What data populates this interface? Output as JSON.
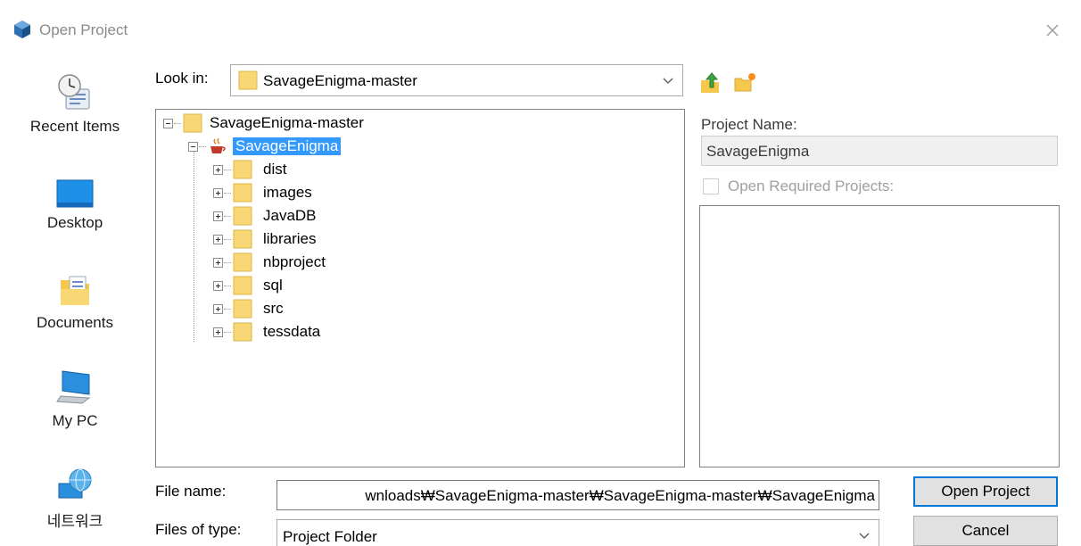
{
  "window": {
    "title": "Open Project",
    "icon": "netbeans-cube-icon"
  },
  "places": [
    {
      "label": "Recent Items",
      "icon": "recent-items-icon"
    },
    {
      "label": "Desktop",
      "icon": "desktop-icon"
    },
    {
      "label": "Documents",
      "icon": "documents-icon"
    },
    {
      "label": "My PC",
      "icon": "computer-icon"
    },
    {
      "label": "네트워크",
      "icon": "network-icon"
    }
  ],
  "lookin": {
    "label": "Look in:",
    "value": "SavageEnigma-master"
  },
  "toolbar": {
    "up_icon": "up-folder-icon",
    "new_folder_icon": "new-folder-icon"
  },
  "tree": {
    "root": "SavageEnigma-master",
    "project": "SavageEnigma",
    "children": [
      "dist",
      "images",
      "JavaDB",
      "libraries",
      "nbproject",
      "sql",
      "src",
      "tessdata"
    ]
  },
  "panel": {
    "project_name_label": "Project Name:",
    "project_name_value": "SavageEnigma",
    "open_required_label": "Open Required Projects:"
  },
  "filename": {
    "label": "File name:",
    "value": "wnloads₩SavageEnigma-master₩SavageEnigma-master₩SavageEnigma"
  },
  "filetype": {
    "label": "Files of type:",
    "value": "Project Folder"
  },
  "buttons": {
    "open": "Open Project",
    "cancel": "Cancel"
  },
  "colors": {
    "selection": "#3399ff",
    "folder": "#f8d775",
    "accent": "#0078d7"
  }
}
